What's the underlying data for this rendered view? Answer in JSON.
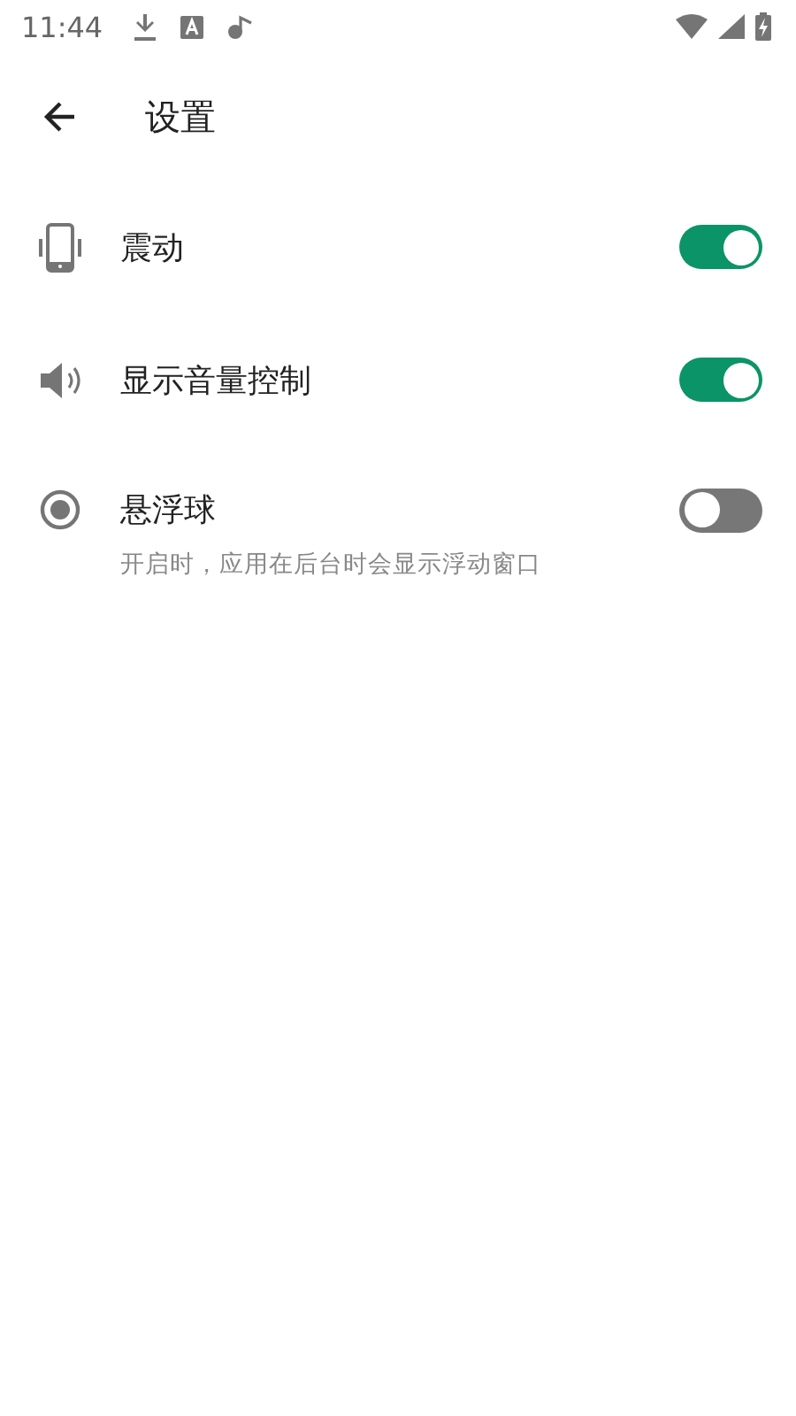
{
  "status_bar": {
    "time": "11:44"
  },
  "toolbar": {
    "title": "设置"
  },
  "settings": [
    {
      "kind": "vibrate",
      "label": "震动",
      "on": true
    },
    {
      "kind": "volume",
      "label": "显示音量控制",
      "on": true
    },
    {
      "kind": "bubble",
      "label": "悬浮球",
      "on": false,
      "description": "开启时，应用在后台时会显示浮动窗口"
    }
  ]
}
